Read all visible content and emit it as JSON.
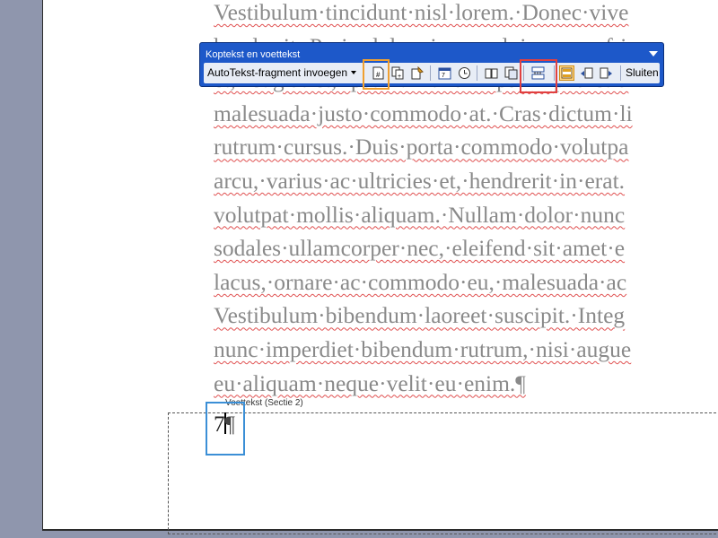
{
  "document": {
    "lines": [
      "Vestibulum·tincidunt·nisl·lorem.·Donec·vive",
      "hendrerit.·Proin·dolor·risus,·pulvinar·non·fri",
      "et,·feugiat·et,·ipsum.·Nullam·ipsum·pharetra",
      "malesuada·justo·commodo·at.·Cras·dictum·li",
      "rutrum·cursus.·Duis·porta·commodo·volutpa",
      "arcu,·varius·ac·ultricies·et,·hendrerit·in·erat.",
      "volutpat·mollis·aliquam.·Nullam·dolor·nunc",
      "sodales·ullamcorper·nec,·eleifend·sit·amet·e",
      "lacus,·ornare·ac·commodo·eu,·malesuada·ac",
      "Vestibulum·bibendum·laoreet·suscipit.·Integ",
      "nunc·imperdiet·bibendum·rutrum,·nisi·augue",
      "eu·aliquam·neque·velit·eu·enim.¶"
    ]
  },
  "footer": {
    "label": "Voettekst (Sectie 2)",
    "page_number": "7",
    "pilcrow": "¶"
  },
  "toolbar": {
    "title": "Koptekst en voettekst",
    "autotext_label": "AutoTekst-fragment invoegen",
    "close_label": "Sluiten",
    "buttons": [
      {
        "name": "insert-page-number",
        "icon": "page-number-icon"
      },
      {
        "name": "insert-page-count",
        "icon": "page-count-icon"
      },
      {
        "name": "format-page-number",
        "icon": "format-page-number-icon"
      },
      {
        "name": "insert-date",
        "icon": "date-icon"
      },
      {
        "name": "insert-time",
        "icon": "clock-icon"
      },
      {
        "name": "page-setup",
        "icon": "page-setup-icon"
      },
      {
        "name": "show-hide-document-text",
        "icon": "show-document-text-icon"
      },
      {
        "name": "link-to-previous",
        "icon": "same-as-previous-icon"
      },
      {
        "name": "switch-header-footer",
        "icon": "switch-header-footer-icon"
      },
      {
        "name": "show-previous",
        "icon": "show-previous-icon"
      },
      {
        "name": "show-next",
        "icon": "show-next-icon"
      }
    ]
  },
  "colors": {
    "toolbar_blue": "#1d58c9",
    "highlight_orange": "#f0a030",
    "highlight_red": "#e14040",
    "highlight_blue": "#3b8fd6",
    "spelling_underline": "#e05050"
  }
}
